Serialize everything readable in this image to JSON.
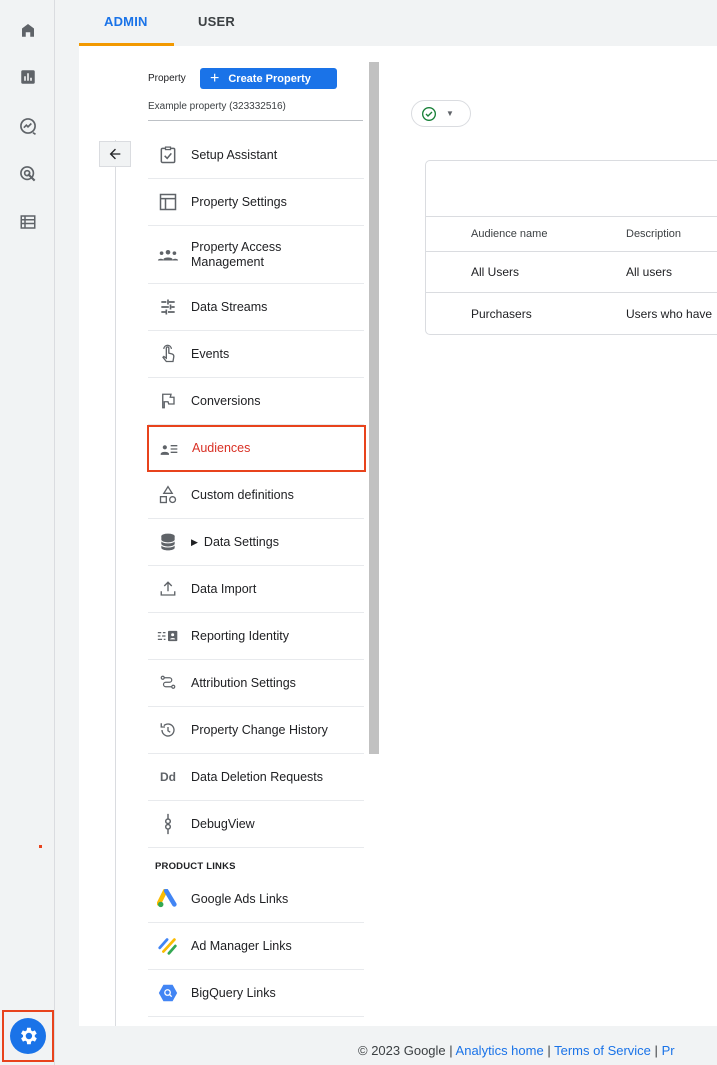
{
  "tabs": {
    "admin": "ADMIN",
    "user": "USER"
  },
  "property": {
    "label": "Property",
    "create_button": "Create Property",
    "name": "Example property (323332516)"
  },
  "menu": [
    {
      "label": "Setup Assistant",
      "icon": "checklist-icon"
    },
    {
      "label": "Property Settings",
      "icon": "property-settings-icon"
    },
    {
      "label": "Property Access\nManagement",
      "icon": "people-icon"
    },
    {
      "label": "Data Streams",
      "icon": "data-streams-icon"
    },
    {
      "label": "Events",
      "icon": "touch-icon"
    },
    {
      "label": "Conversions",
      "icon": "flag-icon"
    },
    {
      "label": "Audiences",
      "icon": "audience-icon",
      "active": true
    },
    {
      "label": "Custom definitions",
      "icon": "shapes-icon"
    },
    {
      "label": "Data Settings",
      "icon": "database-icon"
    },
    {
      "label": "Data Import",
      "icon": "upload-icon"
    },
    {
      "label": "Reporting Identity",
      "icon": "identity-icon"
    },
    {
      "label": "Attribution Settings",
      "icon": "attribution-icon"
    },
    {
      "label": "Property Change History",
      "icon": "history-icon"
    },
    {
      "label": "Data Deletion Requests",
      "icon": "dd-icon"
    },
    {
      "label": "DebugView",
      "icon": "debug-icon"
    }
  ],
  "product_links": {
    "title": "PRODUCT LINKS",
    "items": [
      {
        "label": "Google Ads Links",
        "icon": "google-ads-icon"
      },
      {
        "label": "Ad Manager Links",
        "icon": "ad-manager-icon"
      },
      {
        "label": "BigQuery Links",
        "icon": "bigquery-icon"
      }
    ]
  },
  "audiences_table": {
    "columns": [
      "Audience name",
      "Description"
    ],
    "rows": [
      [
        "All Users",
        "All users"
      ],
      [
        "Purchasers",
        "Users who have"
      ]
    ]
  },
  "footer": {
    "copyright": "© 2023 Google |",
    "analytics_home": "Analytics home",
    "sep1": "|",
    "terms": "Terms of Service",
    "sep2": "|",
    "privacy": "Pr"
  },
  "colors": {
    "accent": "#1a73e8",
    "highlight": "#e8431c",
    "active_text": "#d93025",
    "tab_underline": "#f29900"
  }
}
